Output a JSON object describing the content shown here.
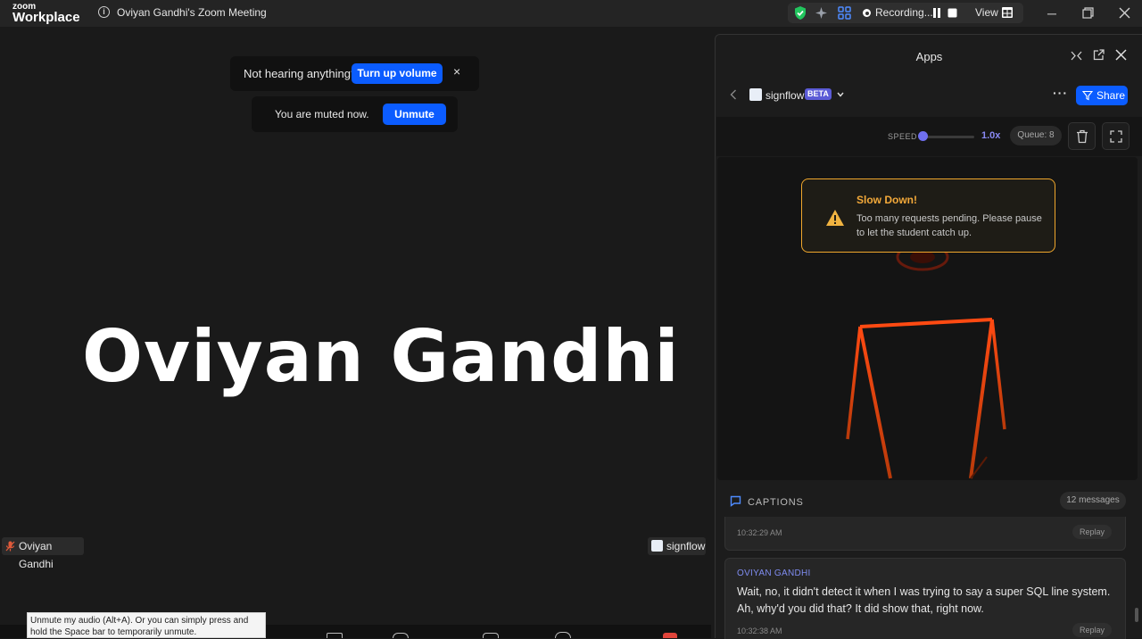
{
  "titlebar": {
    "logo_small": "zoom",
    "logo_big": "Workplace",
    "meeting_title": "Oviyan Gandhi's Zoom Meeting",
    "recording_label": "Recording...",
    "view_label": "View",
    "icons": [
      "shield-check-icon",
      "sparkle-icon",
      "apps-icon",
      "pause-icon",
      "stop-icon",
      "grid-icon",
      "minimize-icon",
      "restore-icon",
      "close-icon"
    ]
  },
  "main": {
    "participant_name_big": "Oviyan Gandhi",
    "toast_volume": {
      "text": "Not hearing anything?",
      "button": "Turn up volume",
      "close": "×"
    },
    "toast_muted": {
      "text": "You are muted now.",
      "button": "Unmute"
    },
    "name_tag": "Oviyan Gandhi",
    "app_tag": "signflow",
    "tooltip": "Unmute my audio (Alt+A). Or you can simply press and hold the Space bar to temporarily unmute."
  },
  "apps_panel": {
    "title": "Apps",
    "app_name": "signflow",
    "badge": "BETA",
    "share_label": "Share",
    "speed": {
      "label": "SPEED",
      "value": "1.0x",
      "level": 0.0
    },
    "queue_label": "Queue: 8",
    "alert": {
      "title": "Slow Down!",
      "body": "Too many requests pending. Please pause to let the student catch up."
    },
    "captions": {
      "title": "CAPTIONS",
      "count": "12 messages",
      "items": [
        {
          "time": "10:32:29 AM",
          "replay": "Replay"
        },
        {
          "speaker": "OVIYAN GANDHI",
          "text": "Wait, no, it didn't detect it when I was trying to say a super SQL line system. Ah, why'd you did that? It did show that, right now.",
          "time": "10:32:38 AM",
          "replay": "Replay"
        }
      ]
    }
  },
  "colors": {
    "accent_blue": "#0b5cff",
    "alert_orange": "#f0a72c",
    "speaker_purple": "#7f8cf0"
  }
}
